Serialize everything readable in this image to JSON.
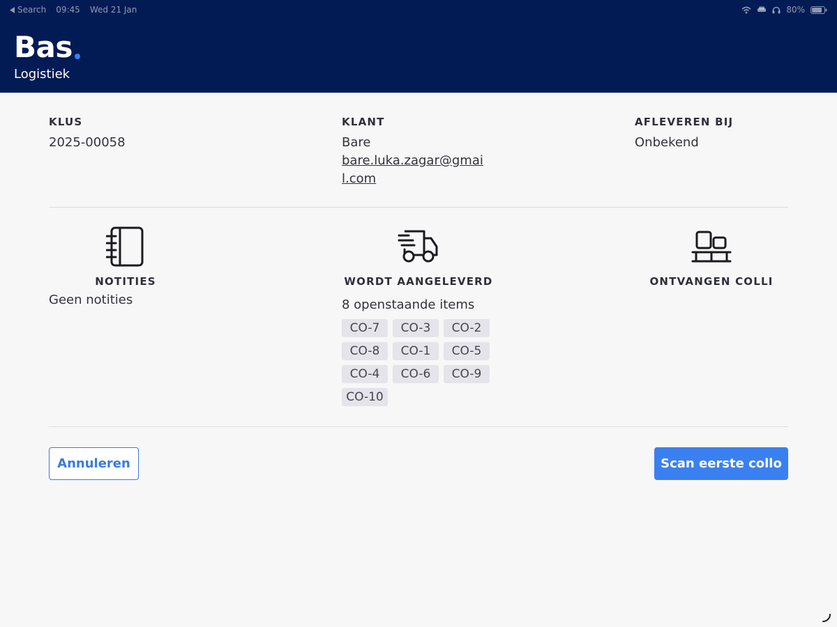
{
  "statusbar": {
    "back_label": "Search",
    "time": "09:45",
    "date": "Wed 21 Jan",
    "battery": "80%"
  },
  "header": {
    "logo_text": "Bas",
    "subtitle": "Logistiek"
  },
  "info": {
    "job": {
      "label": "KLUS",
      "value": "2025-00058"
    },
    "customer": {
      "label": "KLANT",
      "name": "Bare",
      "email": "bare.luka.zagar@gmail.com"
    },
    "deliver": {
      "label": "AFLEVEREN BIJ",
      "value": "Onbekend"
    }
  },
  "notes": {
    "label": "NOTITIES",
    "text": "Geen notities"
  },
  "delivery": {
    "label": "WORDT AANGELEVERD",
    "count_text": "8 openstaande items",
    "items": [
      "CO-7",
      "CO-3",
      "CO-2",
      "CO-8",
      "CO-1",
      "CO-5",
      "CO-4",
      "CO-6",
      "CO-9",
      "CO-10"
    ]
  },
  "received": {
    "label": "ONTVANGEN COLLI"
  },
  "actions": {
    "cancel_label": "Annuleren",
    "scan_label": "Scan eerste collo"
  },
  "colors": {
    "header_bg": "#021b55",
    "accent": "#3b80f0",
    "tag_bg": "#e4e4ea"
  }
}
